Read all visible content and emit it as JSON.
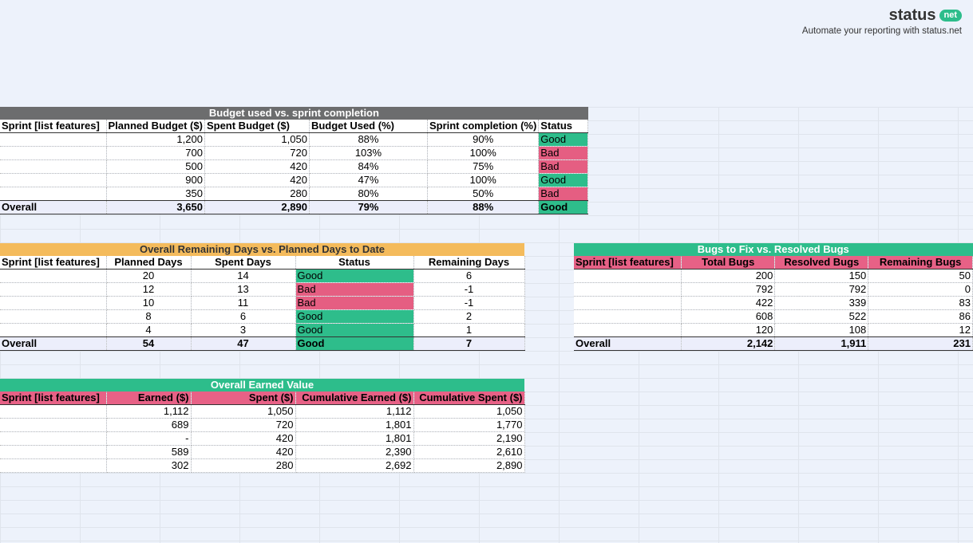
{
  "branding": {
    "logo_prefix": "status",
    "logo_suffix": "net",
    "tagline": "Automate your reporting with status.net"
  },
  "budget": {
    "title": "Budget used vs. sprint completion",
    "headers": [
      "Sprint [list features]",
      "Planned Budget ($)",
      "Spent Budget ($)",
      "Budget Used (%)",
      "Sprint completion (%)",
      "Status"
    ],
    "rows": [
      {
        "sprint": "",
        "planned": "1,200",
        "spent": "1,050",
        "used": "88%",
        "completion": "90%",
        "status": "Good"
      },
      {
        "sprint": "",
        "planned": "700",
        "spent": "720",
        "used": "103%",
        "completion": "100%",
        "status": "Bad"
      },
      {
        "sprint": "",
        "planned": "500",
        "spent": "420",
        "used": "84%",
        "completion": "75%",
        "status": "Bad"
      },
      {
        "sprint": "",
        "planned": "900",
        "spent": "420",
        "used": "47%",
        "completion": "100%",
        "status": "Good"
      },
      {
        "sprint": "",
        "planned": "350",
        "spent": "280",
        "used": "80%",
        "completion": "50%",
        "status": "Bad"
      }
    ],
    "overall": {
      "label": "Overall",
      "planned": "3,650",
      "spent": "2,890",
      "used": "79%",
      "completion": "88%",
      "status": "Good"
    }
  },
  "days": {
    "title": "Overall Remaining Days vs. Planned Days to Date",
    "headers": [
      "Sprint [list features]",
      "Planned Days",
      "Spent Days",
      "Status",
      "Remaining Days"
    ],
    "rows": [
      {
        "sprint": "",
        "planned": "20",
        "spent": "14",
        "status": "Good",
        "remaining": "6"
      },
      {
        "sprint": "",
        "planned": "12",
        "spent": "13",
        "status": "Bad",
        "remaining": "-1"
      },
      {
        "sprint": "",
        "planned": "10",
        "spent": "11",
        "status": "Bad",
        "remaining": "-1"
      },
      {
        "sprint": "",
        "planned": "8",
        "spent": "6",
        "status": "Good",
        "remaining": "2"
      },
      {
        "sprint": "",
        "planned": "4",
        "spent": "3",
        "status": "Good",
        "remaining": "1"
      }
    ],
    "overall": {
      "label": "Overall",
      "planned": "54",
      "spent": "47",
      "status": "Good",
      "remaining": "7"
    }
  },
  "bugs": {
    "title": "Bugs to Fix vs. Resolved Bugs",
    "headers": [
      "Sprint [list features]",
      "Total Bugs",
      "Resolved Bugs",
      "Remaining Bugs"
    ],
    "rows": [
      {
        "sprint": "",
        "total": "200",
        "resolved": "150",
        "remaining": "50"
      },
      {
        "sprint": "",
        "total": "792",
        "resolved": "792",
        "remaining": "0"
      },
      {
        "sprint": "",
        "total": "422",
        "resolved": "339",
        "remaining": "83"
      },
      {
        "sprint": "",
        "total": "608",
        "resolved": "522",
        "remaining": "86"
      },
      {
        "sprint": "",
        "total": "120",
        "resolved": "108",
        "remaining": "12"
      }
    ],
    "overall": {
      "label": "Overall",
      "total": "2,142",
      "resolved": "1,911",
      "remaining": "231"
    }
  },
  "earned": {
    "title": "Overall Earned Value",
    "headers": [
      "Sprint [list features]",
      "Earned ($)",
      "Spent ($)",
      "Cumulative Earned ($)",
      "Cumulative Spent ($)"
    ],
    "rows": [
      {
        "sprint": "",
        "earned": "1,112",
        "spent": "1,050",
        "cearned": "1,112",
        "cspent": "1,050"
      },
      {
        "sprint": "",
        "earned": "689",
        "spent": "720",
        "cearned": "1,801",
        "cspent": "1,770"
      },
      {
        "sprint": "",
        "earned": "-",
        "spent": "420",
        "cearned": "1,801",
        "cspent": "2,190"
      },
      {
        "sprint": "",
        "earned": "589",
        "spent": "420",
        "cearned": "2,390",
        "cspent": "2,610"
      },
      {
        "sprint": "",
        "earned": "302",
        "spent": "280",
        "cearned": "2,692",
        "cspent": "2,890"
      }
    ]
  }
}
